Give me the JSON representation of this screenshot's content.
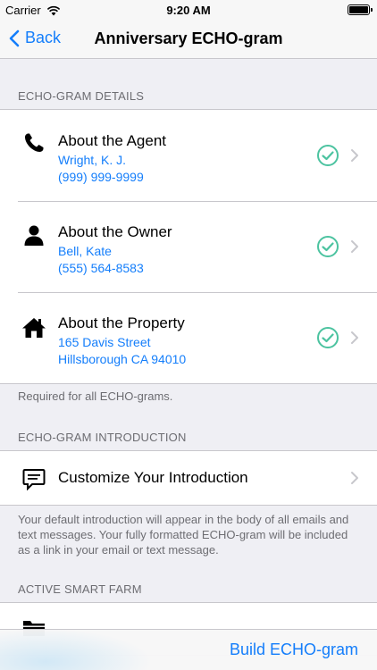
{
  "status": {
    "carrier": "Carrier",
    "time": "9:20 AM"
  },
  "nav": {
    "back_label": "Back",
    "title": "Anniversary ECHO-gram"
  },
  "details": {
    "header": "ECHO-GRAM DETAILS",
    "agent": {
      "title": "About the Agent",
      "line1": "Wright, K. J.",
      "line2": "(999) 999-9999"
    },
    "owner": {
      "title": "About the Owner",
      "line1": "Bell, Kate",
      "line2": "(555) 564-8583"
    },
    "property": {
      "title": "About the Property",
      "line1": "165 Davis Street",
      "line2": "Hillsborough CA 94010"
    },
    "footer": "Required for all ECHO-grams."
  },
  "intro": {
    "header": "ECHO-GRAM INTRODUCTION",
    "title": "Customize Your Introduction",
    "footer": "Your default introduction will appear in the body of all emails and text messages. Your fully formatted ECHO-gram will be included as a link in your email or text message."
  },
  "farm": {
    "header": "ACTIVE SMART FARM"
  },
  "bottom": {
    "build_label": "Build ECHO-gram"
  },
  "icons": {
    "agent": "phone-icon",
    "owner": "person-icon",
    "property": "house-icon",
    "intro": "speech-bubble-icon",
    "farm": "folder-icon",
    "status": "check-circle-icon"
  },
  "colors": {
    "accent": "#147efb",
    "check": "#4cc3a0",
    "chevron": "#c7c7cc"
  }
}
